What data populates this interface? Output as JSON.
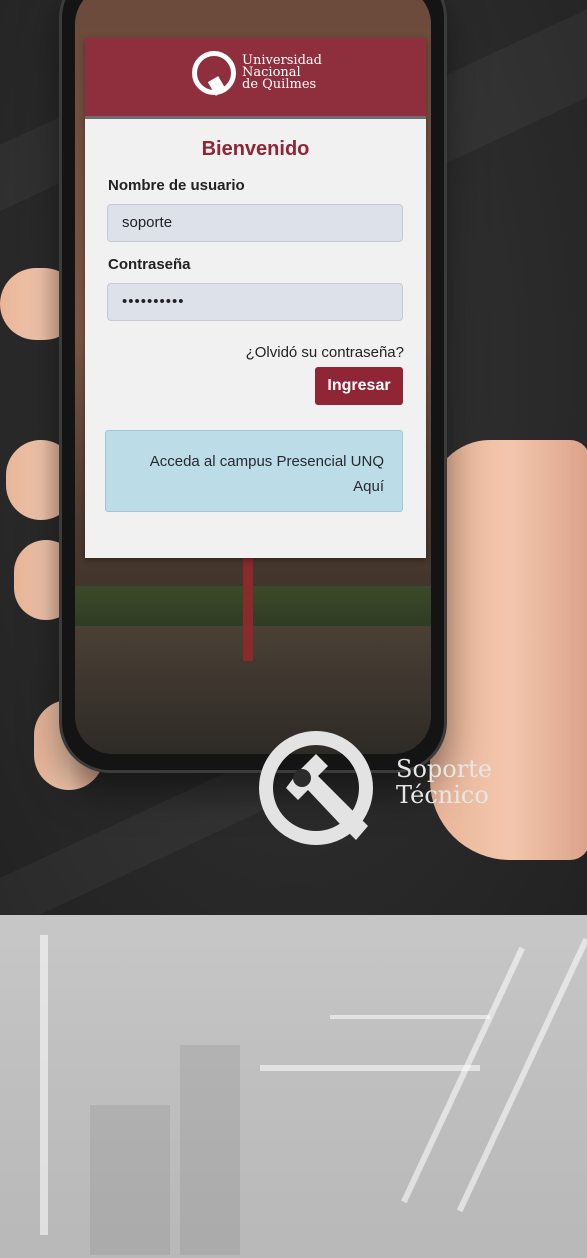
{
  "logo": {
    "line1": "Universidad",
    "line2": "Nacional",
    "line3": "de Quilmes"
  },
  "login": {
    "title": "Bienvenido",
    "username_label": "Nombre de usuario",
    "username_value": "soporte",
    "password_label": "Contraseña",
    "password_value": "••••••••••",
    "forgot_link": "¿Olvidó su contraseña?",
    "submit_label": "Ingresar"
  },
  "campus_box": {
    "line1": "Acceda al campus Presencial UNQ",
    "link": "Aquí"
  },
  "branding": {
    "line1": "Soporte",
    "line2": "Técnico"
  },
  "colors": {
    "brand": "#8f2535",
    "header": "#8f2f3e",
    "info_box": "#bcdce8"
  }
}
